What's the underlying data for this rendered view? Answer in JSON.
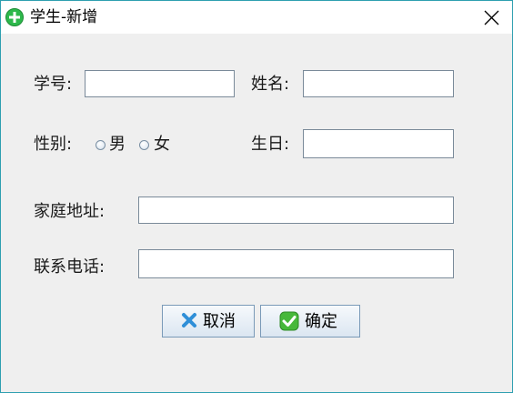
{
  "window": {
    "title": "学生-新增"
  },
  "form": {
    "student_id_label": "学号:",
    "student_id_value": "",
    "name_label": "姓名:",
    "name_value": "",
    "gender_label": "性别:",
    "gender_options": [
      "男",
      "女"
    ],
    "birthday_label": "生日:",
    "birthday_value": "",
    "address_label": "家庭地址:",
    "address_value": "",
    "phone_label": "联系电话:",
    "phone_value": ""
  },
  "buttons": {
    "cancel_label": "取消",
    "confirm_label": "确定"
  },
  "icons": {
    "title": "add-circle-icon",
    "close": "close-icon",
    "cancel": "cross-icon",
    "confirm": "check-icon"
  },
  "colors": {
    "window_border": "#2e9fb0",
    "background": "#efefef",
    "add_icon": "#2db84b",
    "cancel_icon": "#2f8fd8",
    "confirm_icon": "#47b83a"
  }
}
